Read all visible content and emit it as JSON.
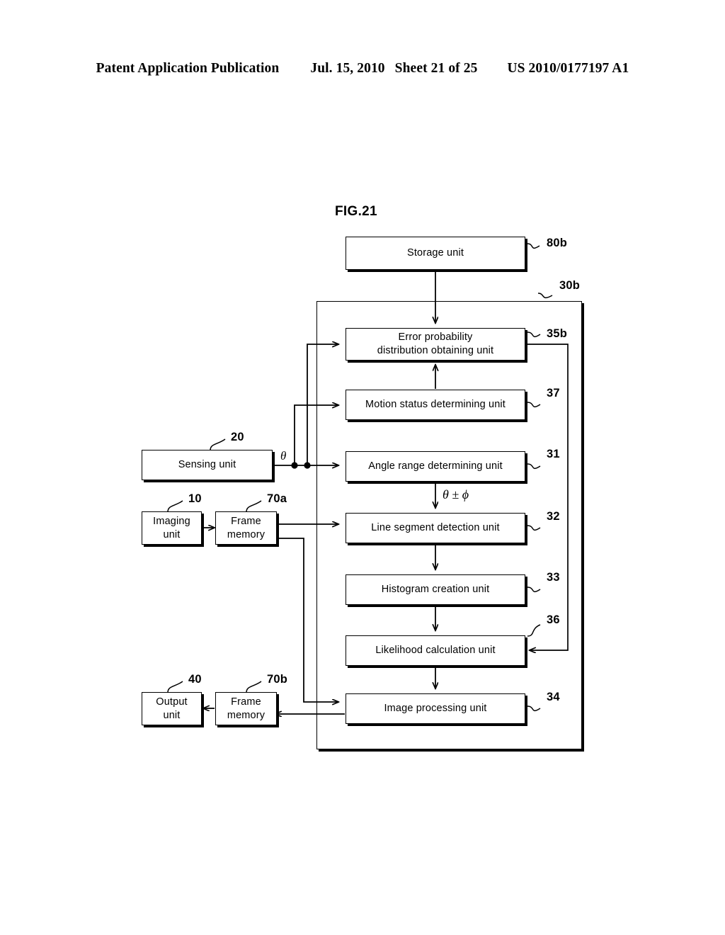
{
  "header": {
    "publication": "Patent Application Publication",
    "date": "Jul. 15, 2010",
    "sheet": "Sheet 21 of 25",
    "docnumber": "US 2010/0177197 A1"
  },
  "figure": {
    "title": "FIG.21"
  },
  "diagram": {
    "type": "block-diagram",
    "group_label": "30b",
    "blocks": [
      {
        "id": "80b",
        "label": "Storage unit",
        "ref": "80b"
      },
      {
        "id": "35b",
        "label": "Error probability\ndistribution obtaining unit",
        "ref": "35b"
      },
      {
        "id": "37",
        "label": "Motion status determining unit",
        "ref": "37"
      },
      {
        "id": "31",
        "label": "Angle range determining unit",
        "ref": "31"
      },
      {
        "id": "32",
        "label": "Line segment detection unit",
        "ref": "32"
      },
      {
        "id": "33",
        "label": "Histogram creation unit",
        "ref": "33"
      },
      {
        "id": "36",
        "label": "Likelihood calculation unit",
        "ref": "36"
      },
      {
        "id": "34",
        "label": "Image processing unit",
        "ref": "34"
      },
      {
        "id": "20",
        "label": "Sensing unit",
        "ref": "20"
      },
      {
        "id": "10",
        "label": "Imaging\nunit",
        "ref": "10"
      },
      {
        "id": "70a",
        "label": "Frame\nmemory",
        "ref": "70a"
      },
      {
        "id": "40",
        "label": "Output\nunit",
        "ref": "40"
      },
      {
        "id": "70b",
        "label": "Frame\nmemory",
        "ref": "70b"
      }
    ],
    "signals": [
      {
        "id": "theta",
        "label": "θ"
      },
      {
        "id": "theta-range",
        "label": "θ ± ϕ"
      }
    ],
    "colors": {
      "ink": "#000000",
      "paper": "#ffffff"
    }
  }
}
